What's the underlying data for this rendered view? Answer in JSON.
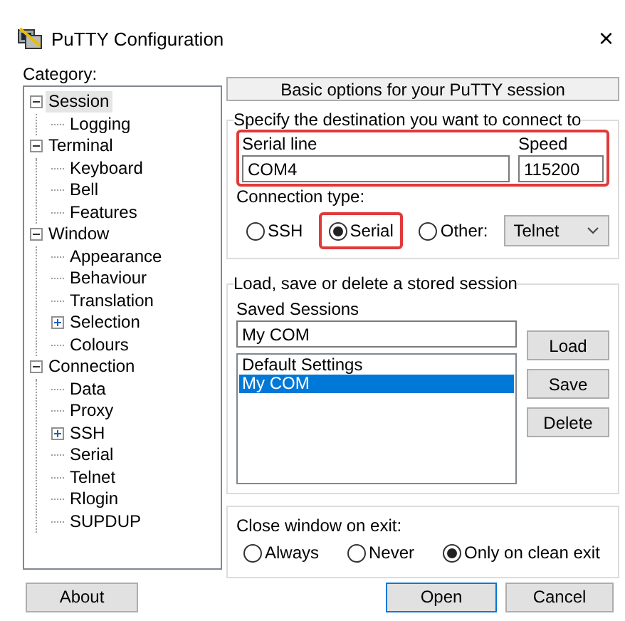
{
  "window": {
    "title": "PuTTY Configuration",
    "close": "×"
  },
  "category": {
    "label": "Category:",
    "tree": [
      {
        "label": "Session",
        "selected": true,
        "expanded": true,
        "children": [
          {
            "label": "Logging",
            "selected": false
          }
        ]
      },
      {
        "label": "Terminal",
        "selected": false,
        "expanded": true,
        "children": [
          {
            "label": "Keyboard",
            "selected": false
          },
          {
            "label": "Bell",
            "selected": false
          },
          {
            "label": "Features",
            "selected": false
          }
        ]
      },
      {
        "label": "Window",
        "selected": false,
        "expanded": true,
        "children": [
          {
            "label": "Appearance",
            "selected": false
          },
          {
            "label": "Behaviour",
            "selected": false
          },
          {
            "label": "Translation",
            "selected": false
          },
          {
            "label": "Selection",
            "selected": false,
            "expanded": false
          },
          {
            "label": "Colours",
            "selected": false
          }
        ]
      },
      {
        "label": "Connection",
        "selected": false,
        "expanded": true,
        "children": [
          {
            "label": "Data",
            "selected": false
          },
          {
            "label": "Proxy",
            "selected": false
          },
          {
            "label": "SSH",
            "selected": false,
            "expanded": false
          },
          {
            "label": "Serial",
            "selected": false
          },
          {
            "label": "Telnet",
            "selected": false
          },
          {
            "label": "Rlogin",
            "selected": false
          },
          {
            "label": "SUPDUP",
            "selected": false
          }
        ]
      }
    ]
  },
  "panel": {
    "heading": "Basic options for your PuTTY session",
    "destination": {
      "legend": "Specify the destination you want to connect to",
      "highlighted": true,
      "serial_line": {
        "label": "Serial line",
        "value": "COM4"
      },
      "speed": {
        "label": "Speed",
        "value": "115200"
      },
      "connection_type": {
        "label": "Connection type:",
        "options": [
          {
            "label": "SSH",
            "selected": false,
            "kind": "plain"
          },
          {
            "label": "Serial",
            "selected": true,
            "kind": "framed"
          },
          {
            "label": "Other:",
            "selected": false,
            "kind": "plain"
          }
        ]
      },
      "protocol_select": {
        "value": "Telnet"
      }
    },
    "sessions": {
      "legend": "Load, save or delete a stored session",
      "saved_label": "Saved Sessions",
      "saved_value": "My COM",
      "list": [
        {
          "label": "Default Settings",
          "selected": false
        },
        {
          "label": "My COM",
          "selected": true
        }
      ],
      "buttons": [
        "Load",
        "Save",
        "Delete"
      ]
    },
    "close_on_exit": {
      "label": "Close window on exit:",
      "options": [
        {
          "label": "Always",
          "selected": false
        },
        {
          "label": "Never",
          "selected": false
        },
        {
          "label": "Only on clean exit",
          "selected": true
        }
      ]
    }
  },
  "buttons": {
    "about": "About",
    "open": "Open",
    "cancel": "Cancel"
  }
}
